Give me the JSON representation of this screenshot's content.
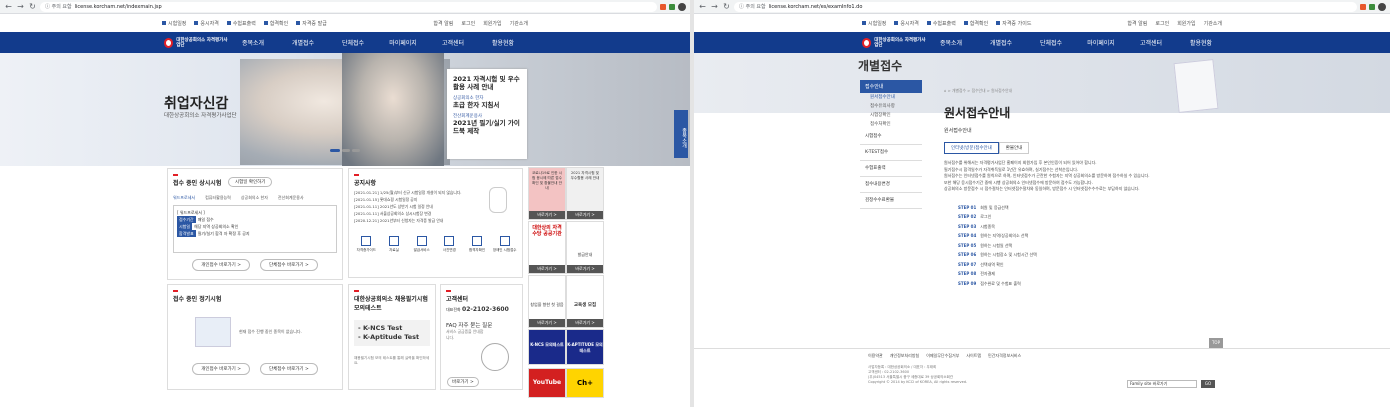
{
  "browserL": {
    "warn": "ⓘ 주의 요함",
    "host": "license.korcham.net/indexmain.jsp"
  },
  "browserR": {
    "warn": "ⓘ 주의 요함",
    "host": "license.korcham.net/es/examInfo1.do"
  },
  "util": {
    "left": [
      "시험일정",
      "응시자격",
      "수험표출력",
      "합격확인",
      "자격증 발급"
    ],
    "right": [
      "합격 알림",
      "로그인",
      "회원가입",
      "기관소개"
    ]
  },
  "utilR": {
    "left": [
      "시험일정",
      "응시자격",
      "수험표출력",
      "합격확인",
      "자격증 가이드"
    ],
    "right": [
      "합격 알림",
      "로그인",
      "회원가입",
      "기관소개"
    ]
  },
  "logo": "대한상공회의소 자격평가사업단",
  "menu": [
    "종목소개",
    "개별접수",
    "단체접수",
    "마이페이지",
    "고객센터",
    "활용현황"
  ],
  "hero": {
    "title": "취업자신감",
    "sub": "대한상공회의소 자격평가사업단",
    "card_title": "2021 자격시험 및 우수활용 사례 안내",
    "card_sub1": "상공회의소 한자",
    "card_t2": "초급 한자 지침서",
    "card_sub2": "전산회계운용사",
    "card_t3": "2021년 필기/실기 가이드북 제작"
  },
  "side_btn": "종목소개",
  "exam": {
    "title": "접수 중인 상시시험",
    "select": "시험일 확인하기",
    "tabs": [
      "워드프로세서",
      "컴퓨터활용능력",
      "상공회의소 한자",
      "전산회계운용사"
    ],
    "box": "[ 워드프로세서 ]",
    "rows": [
      "접수기간",
      "시험일",
      "합격발표"
    ],
    "row_text": [
      "매일 접수",
      "해당 지역 상공회의소 확인",
      "필기/실기 합격 자 확정 후 공지"
    ],
    "btn1": "개인접수 바로가기 >",
    "btn2": "단체접수 바로가기 >"
  },
  "notice": {
    "title": "공지사항",
    "items": [
      "[2021.01.21] 1/25(월)부터 신규 시험일정 개설이 되지 않습니다.",
      "[2021.01.15] 롯데쇼핑 시험일정 공지",
      "[2021.01.11] 2021년도 상반기 시험 일정 안내",
      "[2021.01.11] 서울상공회의소 상시시험장 변경",
      "[2020.12.21] 2021년부터 신청자는 자격증 발급 안내"
    ]
  },
  "icons": [
    "자격증가이드",
    "자료실",
    "발급서비스",
    "사진변경",
    "합격자확인",
    "장애인 시험접수"
  ],
  "regular": {
    "title": "접수 중인 정기시험",
    "empty": "현재 접수 진행 중인 종목이 없습니다.",
    "btn1": "개인접수 바로가기 >",
    "btn2": "단체접수 바로가기 >"
  },
  "mock": {
    "title": "대한상공회의소 채용필기시험 모의테스트",
    "l1": "- K-NCS Test",
    "l2": "- K-Aptitude Test",
    "desc": "채용필기시험 모의 테스트를 통해 실력을 확인하세요."
  },
  "center": {
    "title": "고객센터",
    "phone": "02-2102-3600",
    "label": "대표전화",
    "faq": "FAQ 자주 묻는 질문",
    "faq_sub": "서비스 궁금증을 안내합니다.",
    "btn": "바로가기 >"
  },
  "banners": [
    {
      "t": "코로나19로 인한 시험 응시에 따른 접수확인 및 환불안내 안내",
      "c": "#f3c3c3"
    },
    {
      "t": "2021 자격시험 및 우수활용 사례 안내",
      "c": "#f0f0f0"
    },
    {
      "t": "대한상의 자격수당 공공기관",
      "c": "#ffffff"
    },
    {
      "t": "발급안내",
      "c": "#ffffff"
    },
    {
      "t": "창업을 향한 첫 걸음",
      "c": "#ffffff"
    },
    {
      "t": "교육생 모집",
      "c": "#ffffff"
    },
    {
      "t": "K-NCS 모의테스트",
      "c": "#1a2a8a"
    },
    {
      "t": "K-APTITUDE 모의테스트",
      "c": "#1a2a8a"
    },
    {
      "t": "YouTube",
      "c": "#d32020"
    },
    {
      "t": "Ch+",
      "c": "#ffd400"
    }
  ],
  "banner_go": "바로가기 >",
  "right": {
    "page_title": "개별접수",
    "lnb_top": "접수안내",
    "lnb_sub": [
      "원서접수안내",
      "접수유의사항",
      "시험장확인",
      "접수처확인"
    ],
    "lnb_items": [
      "시험접수",
      "K-TEST접수",
      "수험표출력",
      "접수내용변경",
      "검정수수료환불"
    ],
    "breadcrumb": "⌂ > 개별접수 > 접수안내 > 원서접수안내",
    "h1": "원서접수안내",
    "h2": "원서접수안내",
    "tab1": "인터넷(방문)접수안내",
    "tab2": "환불안내",
    "bullets": [
      "원서접수를 위해서는 자격평가사업단 홈페이지 회원가입 후 본인인증이 되어 있어야 합니다.",
      "필기접수시 합격일수가 자격취득일로 1년간 유효하며, 실기접수는 선착순입니다.",
      "원서접수는 인터넷접수를 원칙으로 하며, 인터넷접수가 곤란한 수험자는 지역 상공회의소를 방문하여 접수하실 수 있습니다.",
      "또한 해당 응시접수기간 중에 시행 상공회의소 인터넷접수에 방문하여 접수도 가능합니다.",
      "상공회의소 방문접수 시 접수절차는 인터넷접수절차와 동일하며, 방문접수 시 인터넷접수수수료는 부담하지 않습니다."
    ],
    "steps": [
      [
        "STEP 01",
        "회원 및 응급선택"
      ],
      [
        "STEP 02",
        "로그인"
      ],
      [
        "STEP 03",
        "시험종목"
      ],
      [
        "STEP 04",
        "원하는 지역/상공회의소 선택"
      ],
      [
        "STEP 05",
        "원하는 시험일 선택"
      ],
      [
        "STEP 06",
        "원하는 시험장소 및 시험시간 선택"
      ],
      [
        "STEP 07",
        "선택내역 확인"
      ],
      [
        "STEP 08",
        "전자결제"
      ],
      [
        "STEP 09",
        "접수완료 및 수험표 출력"
      ]
    ],
    "top": "TOP"
  },
  "footer": {
    "links": [
      "이용약관",
      "개인정보처리방침",
      "이메일무단수집거부",
      "사이트맵",
      "민간자격정보서비스"
    ],
    "addr": [
      "사업자등록 : 대한상공회의소 / 대표자 : 우태희",
      "고객센터 : 02-2102-3600",
      "(우)04513 서울특별시 중구 세종대로 39 상공회의소회관",
      "Copyright © 2014 by KCCI of KOREA, All rights reserved."
    ],
    "family": "Family site 바로가기",
    "go": "GO"
  }
}
